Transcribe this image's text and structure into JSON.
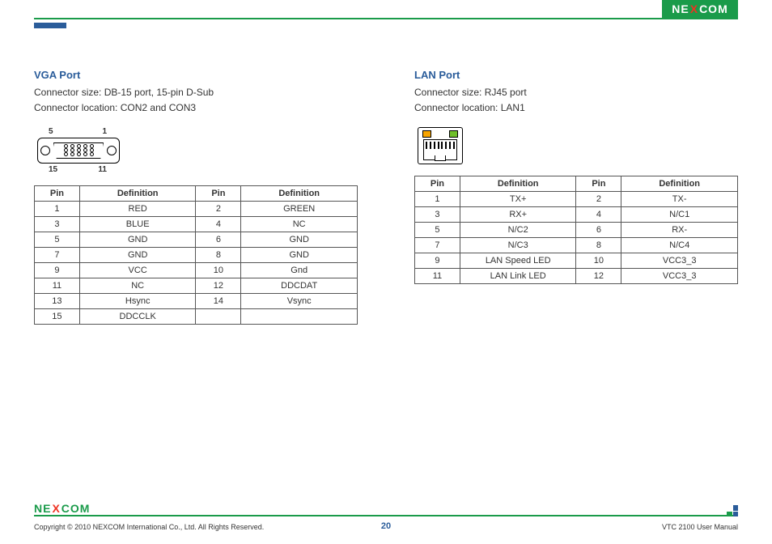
{
  "brand": {
    "name_left": "NE",
    "name_x": "X",
    "name_right": "COM"
  },
  "vga": {
    "title": "VGA Port",
    "size": "Connector size: DB-15 port, 15-pin D-Sub",
    "loc": "Connector location: CON2 and CON3",
    "labels": {
      "tl": "5",
      "tr": "1",
      "bl": "15",
      "br": "11"
    },
    "headers": {
      "pin": "Pin",
      "def": "Definition"
    },
    "rows": [
      {
        "p1": "1",
        "d1": "RED",
        "p2": "2",
        "d2": "GREEN"
      },
      {
        "p1": "3",
        "d1": "BLUE",
        "p2": "4",
        "d2": "NC"
      },
      {
        "p1": "5",
        "d1": "GND",
        "p2": "6",
        "d2": "GND"
      },
      {
        "p1": "7",
        "d1": "GND",
        "p2": "8",
        "d2": "GND"
      },
      {
        "p1": "9",
        "d1": "VCC",
        "p2": "10",
        "d2": "Gnd"
      },
      {
        "p1": "11",
        "d1": "NC",
        "p2": "12",
        "d2": "DDCDAT"
      },
      {
        "p1": "13",
        "d1": "Hsync",
        "p2": "14",
        "d2": "Vsync"
      },
      {
        "p1": "15",
        "d1": "DDCCLK",
        "p2": "",
        "d2": ""
      }
    ]
  },
  "lan": {
    "title": "LAN Port",
    "size": "Connector size: RJ45 port",
    "loc": "Connector location: LAN1",
    "headers": {
      "pin": "Pin",
      "def": "Definition"
    },
    "rows": [
      {
        "p1": "1",
        "d1": "TX+",
        "p2": "2",
        "d2": "TX-"
      },
      {
        "p1": "3",
        "d1": "RX+",
        "p2": "4",
        "d2": "N/C1"
      },
      {
        "p1": "5",
        "d1": "N/C2",
        "p2": "6",
        "d2": "RX-"
      },
      {
        "p1": "7",
        "d1": "N/C3",
        "p2": "8",
        "d2": "N/C4"
      },
      {
        "p1": "9",
        "d1": "LAN Speed LED",
        "p2": "10",
        "d2": "VCC3_3"
      },
      {
        "p1": "11",
        "d1": "LAN Link LED",
        "p2": "12",
        "d2": "VCC3_3"
      }
    ]
  },
  "footer": {
    "copyright": "Copyright © 2010 NEXCOM International Co., Ltd. All Rights Reserved.",
    "page": "20",
    "manual": "VTC 2100 User Manual"
  }
}
